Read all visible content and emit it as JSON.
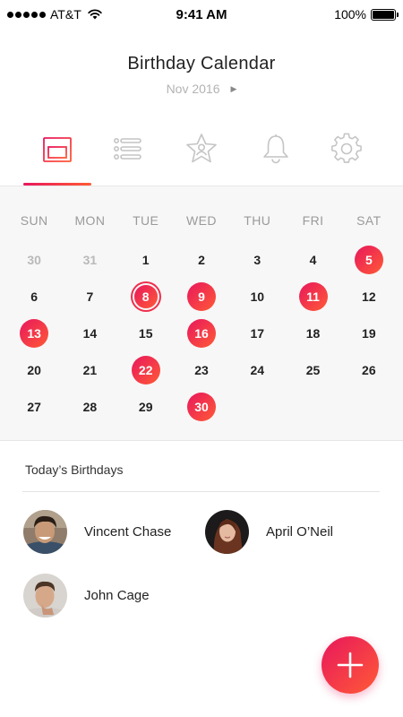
{
  "status_bar": {
    "carrier": "AT&T",
    "time": "9:41 AM",
    "battery": "100%",
    "battery_level": 1.0
  },
  "header": {
    "title": "Birthday Calendar",
    "month": "Nov 2016",
    "next_icon": "play-arrow-icon"
  },
  "tabs": [
    {
      "name": "calendar",
      "icon": "calendar-icon",
      "active": true
    },
    {
      "name": "list",
      "icon": "list-icon",
      "active": false
    },
    {
      "name": "favorites",
      "icon": "star-badge-icon",
      "active": false
    },
    {
      "name": "notifications",
      "icon": "bell-icon",
      "active": false
    },
    {
      "name": "settings",
      "icon": "gear-icon",
      "active": false
    }
  ],
  "colors": {
    "accent_start": "#e8175d",
    "accent_end": "#ff5a36",
    "calendar_bg": "#f7f7f7",
    "muted_text": "#b9b9b9"
  },
  "calendar": {
    "weekdays": [
      "SUN",
      "MON",
      "TUE",
      "WED",
      "THU",
      "FRI",
      "SAT"
    ],
    "days": [
      {
        "label": "30",
        "state": "muted"
      },
      {
        "label": "31",
        "state": "muted"
      },
      {
        "label": "1",
        "state": "normal"
      },
      {
        "label": "2",
        "state": "normal"
      },
      {
        "label": "3",
        "state": "normal"
      },
      {
        "label": "4",
        "state": "normal"
      },
      {
        "label": "5",
        "state": "birthday"
      },
      {
        "label": "6",
        "state": "normal"
      },
      {
        "label": "7",
        "state": "normal"
      },
      {
        "label": "8",
        "state": "today"
      },
      {
        "label": "9",
        "state": "birthday"
      },
      {
        "label": "10",
        "state": "normal"
      },
      {
        "label": "11",
        "state": "birthday"
      },
      {
        "label": "12",
        "state": "normal"
      },
      {
        "label": "13",
        "state": "birthday"
      },
      {
        "label": "14",
        "state": "normal"
      },
      {
        "label": "15",
        "state": "normal"
      },
      {
        "label": "16",
        "state": "birthday"
      },
      {
        "label": "17",
        "state": "normal"
      },
      {
        "label": "18",
        "state": "normal"
      },
      {
        "label": "19",
        "state": "normal"
      },
      {
        "label": "20",
        "state": "normal"
      },
      {
        "label": "21",
        "state": "normal"
      },
      {
        "label": "22",
        "state": "birthday"
      },
      {
        "label": "23",
        "state": "normal"
      },
      {
        "label": "24",
        "state": "normal"
      },
      {
        "label": "25",
        "state": "normal"
      },
      {
        "label": "26",
        "state": "normal"
      },
      {
        "label": "27",
        "state": "normal"
      },
      {
        "label": "28",
        "state": "normal"
      },
      {
        "label": "29",
        "state": "normal"
      },
      {
        "label": "30",
        "state": "birthday"
      }
    ]
  },
  "birthdays": {
    "title": "Today’s Birthdays",
    "people": [
      {
        "name": "Vincent Chase",
        "avatar": "avatar-photo"
      },
      {
        "name": "April O’Neil",
        "avatar": "avatar-photo"
      },
      {
        "name": "John Cage",
        "avatar": "avatar-photo"
      }
    ]
  },
  "fab": {
    "icon": "plus-icon"
  }
}
